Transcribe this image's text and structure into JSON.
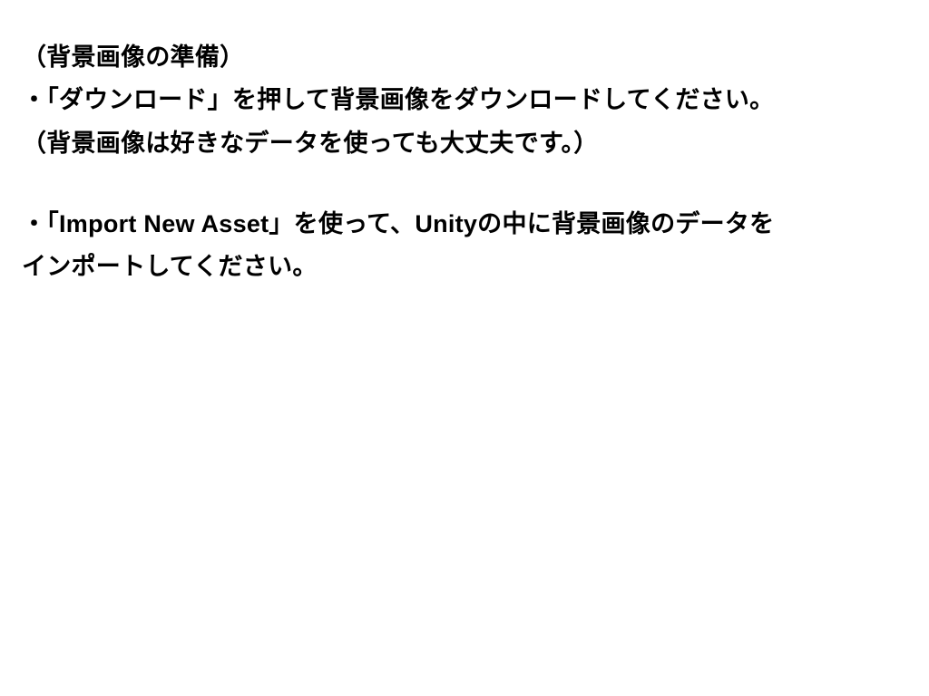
{
  "heading": "（背景画像の準備）",
  "block1": {
    "line1": "・「ダウンロード」を押して背景画像をダウンロードしてください。",
    "line2": "（背景画像は好きなデータを使っても大丈夫です。）"
  },
  "block2": {
    "line1": "・「Import New Asset」を使って、Unityの中に背景画像のデータを",
    "line2": "インポートしてください。"
  }
}
